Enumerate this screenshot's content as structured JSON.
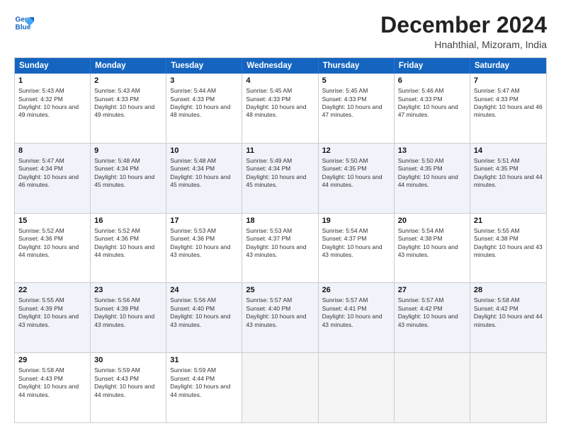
{
  "logo": {
    "line1": "General",
    "line2": "Blue"
  },
  "title": "December 2024",
  "subtitle": "Hnahthial, Mizoram, India",
  "days": [
    "Sunday",
    "Monday",
    "Tuesday",
    "Wednesday",
    "Thursday",
    "Friday",
    "Saturday"
  ],
  "rows": [
    [
      {
        "day": 1,
        "sunrise": "5:43 AM",
        "sunset": "4:32 PM",
        "daylight": "10 hours and 49 minutes."
      },
      {
        "day": 2,
        "sunrise": "5:43 AM",
        "sunset": "4:33 PM",
        "daylight": "10 hours and 49 minutes."
      },
      {
        "day": 3,
        "sunrise": "5:44 AM",
        "sunset": "4:33 PM",
        "daylight": "10 hours and 48 minutes."
      },
      {
        "day": 4,
        "sunrise": "5:45 AM",
        "sunset": "4:33 PM",
        "daylight": "10 hours and 48 minutes."
      },
      {
        "day": 5,
        "sunrise": "5:45 AM",
        "sunset": "4:33 PM",
        "daylight": "10 hours and 47 minutes."
      },
      {
        "day": 6,
        "sunrise": "5:46 AM",
        "sunset": "4:33 PM",
        "daylight": "10 hours and 47 minutes."
      },
      {
        "day": 7,
        "sunrise": "5:47 AM",
        "sunset": "4:33 PM",
        "daylight": "10 hours and 46 minutes."
      }
    ],
    [
      {
        "day": 8,
        "sunrise": "5:47 AM",
        "sunset": "4:34 PM",
        "daylight": "10 hours and 46 minutes."
      },
      {
        "day": 9,
        "sunrise": "5:48 AM",
        "sunset": "4:34 PM",
        "daylight": "10 hours and 45 minutes."
      },
      {
        "day": 10,
        "sunrise": "5:48 AM",
        "sunset": "4:34 PM",
        "daylight": "10 hours and 45 minutes."
      },
      {
        "day": 11,
        "sunrise": "5:49 AM",
        "sunset": "4:34 PM",
        "daylight": "10 hours and 45 minutes."
      },
      {
        "day": 12,
        "sunrise": "5:50 AM",
        "sunset": "4:35 PM",
        "daylight": "10 hours and 44 minutes."
      },
      {
        "day": 13,
        "sunrise": "5:50 AM",
        "sunset": "4:35 PM",
        "daylight": "10 hours and 44 minutes."
      },
      {
        "day": 14,
        "sunrise": "5:51 AM",
        "sunset": "4:35 PM",
        "daylight": "10 hours and 44 minutes."
      }
    ],
    [
      {
        "day": 15,
        "sunrise": "5:52 AM",
        "sunset": "4:36 PM",
        "daylight": "10 hours and 44 minutes."
      },
      {
        "day": 16,
        "sunrise": "5:52 AM",
        "sunset": "4:36 PM",
        "daylight": "10 hours and 44 minutes."
      },
      {
        "day": 17,
        "sunrise": "5:53 AM",
        "sunset": "4:36 PM",
        "daylight": "10 hours and 43 minutes."
      },
      {
        "day": 18,
        "sunrise": "5:53 AM",
        "sunset": "4:37 PM",
        "daylight": "10 hours and 43 minutes."
      },
      {
        "day": 19,
        "sunrise": "5:54 AM",
        "sunset": "4:37 PM",
        "daylight": "10 hours and 43 minutes."
      },
      {
        "day": 20,
        "sunrise": "5:54 AM",
        "sunset": "4:38 PM",
        "daylight": "10 hours and 43 minutes."
      },
      {
        "day": 21,
        "sunrise": "5:55 AM",
        "sunset": "4:38 PM",
        "daylight": "10 hours and 43 minutes."
      }
    ],
    [
      {
        "day": 22,
        "sunrise": "5:55 AM",
        "sunset": "4:39 PM",
        "daylight": "10 hours and 43 minutes."
      },
      {
        "day": 23,
        "sunrise": "5:56 AM",
        "sunset": "4:39 PM",
        "daylight": "10 hours and 43 minutes."
      },
      {
        "day": 24,
        "sunrise": "5:56 AM",
        "sunset": "4:40 PM",
        "daylight": "10 hours and 43 minutes."
      },
      {
        "day": 25,
        "sunrise": "5:57 AM",
        "sunset": "4:40 PM",
        "daylight": "10 hours and 43 minutes."
      },
      {
        "day": 26,
        "sunrise": "5:57 AM",
        "sunset": "4:41 PM",
        "daylight": "10 hours and 43 minutes."
      },
      {
        "day": 27,
        "sunrise": "5:57 AM",
        "sunset": "4:42 PM",
        "daylight": "10 hours and 43 minutes."
      },
      {
        "day": 28,
        "sunrise": "5:58 AM",
        "sunset": "4:42 PM",
        "daylight": "10 hours and 44 minutes."
      }
    ],
    [
      {
        "day": 29,
        "sunrise": "5:58 AM",
        "sunset": "4:43 PM",
        "daylight": "10 hours and 44 minutes."
      },
      {
        "day": 30,
        "sunrise": "5:59 AM",
        "sunset": "4:43 PM",
        "daylight": "10 hours and 44 minutes."
      },
      {
        "day": 31,
        "sunrise": "5:59 AM",
        "sunset": "4:44 PM",
        "daylight": "10 hours and 44 minutes."
      },
      null,
      null,
      null,
      null
    ]
  ],
  "row_alt": [
    false,
    true,
    false,
    true,
    false
  ]
}
